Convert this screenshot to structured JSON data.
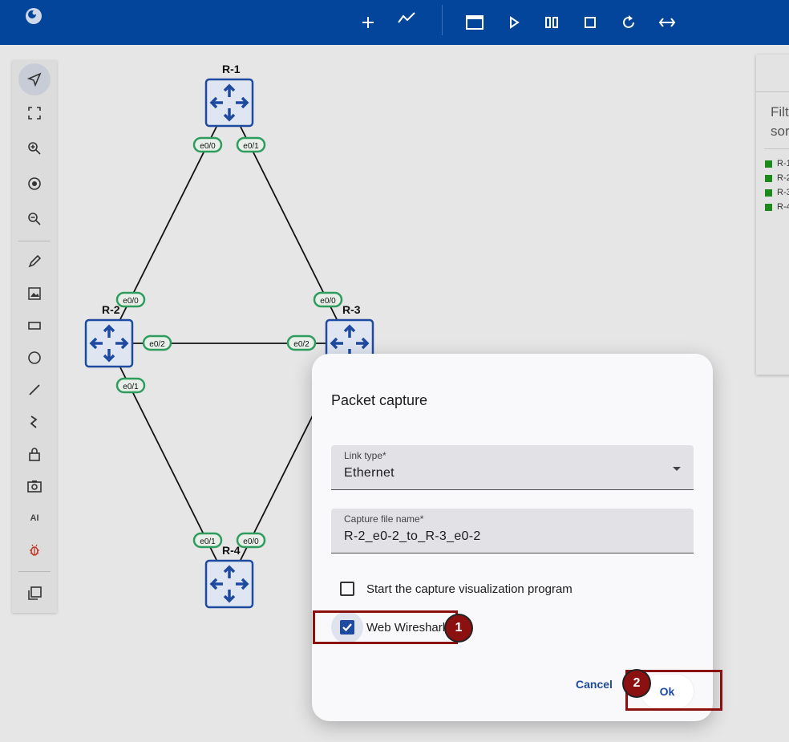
{
  "topbar": {
    "icons": [
      "app-logo-icon",
      "add-icon",
      "chart-icon",
      "console-window-icon",
      "start-icon",
      "suspend-icon",
      "stop-icon",
      "reload-icon",
      "collapse-icon"
    ]
  },
  "toolbar": {
    "ai_label": "AI"
  },
  "topology": {
    "nodes": [
      {
        "name": "R-1"
      },
      {
        "name": "R-2"
      },
      {
        "name": "R-3"
      },
      {
        "name": "R-4"
      }
    ],
    "ports": [
      "e0/0",
      "e0/1",
      "e0/0",
      "e0/2",
      "e0/1",
      "e0/0",
      "e0/2",
      "e0/1",
      "e0/0"
    ]
  },
  "side_panel": {
    "filter_label": "Filt",
    "filter_value": "sor",
    "items": [
      "R-1",
      "R-2",
      "R-3",
      "R-4"
    ],
    "status_color": "#1b8a1b"
  },
  "dialog": {
    "title": "Packet capture",
    "link_type": {
      "label": "Link type*",
      "value": "Ethernet"
    },
    "capture_file": {
      "label": "Capture file name*",
      "value": "R-2_e0-2_to_R-3_e0-2"
    },
    "start_viz": {
      "label": "Start the capture visualization program",
      "checked": false
    },
    "web_wireshark": {
      "label": "Web Wireshark",
      "checked": true
    },
    "cancel_label": "Cancel",
    "ok_label": "Ok"
  },
  "annotations": {
    "markers": [
      "1",
      "2"
    ],
    "color": "#8b1010"
  },
  "colors": {
    "brand": "#02459b",
    "accent": "#1e4aa0",
    "port_green": "#2e9c5c"
  }
}
